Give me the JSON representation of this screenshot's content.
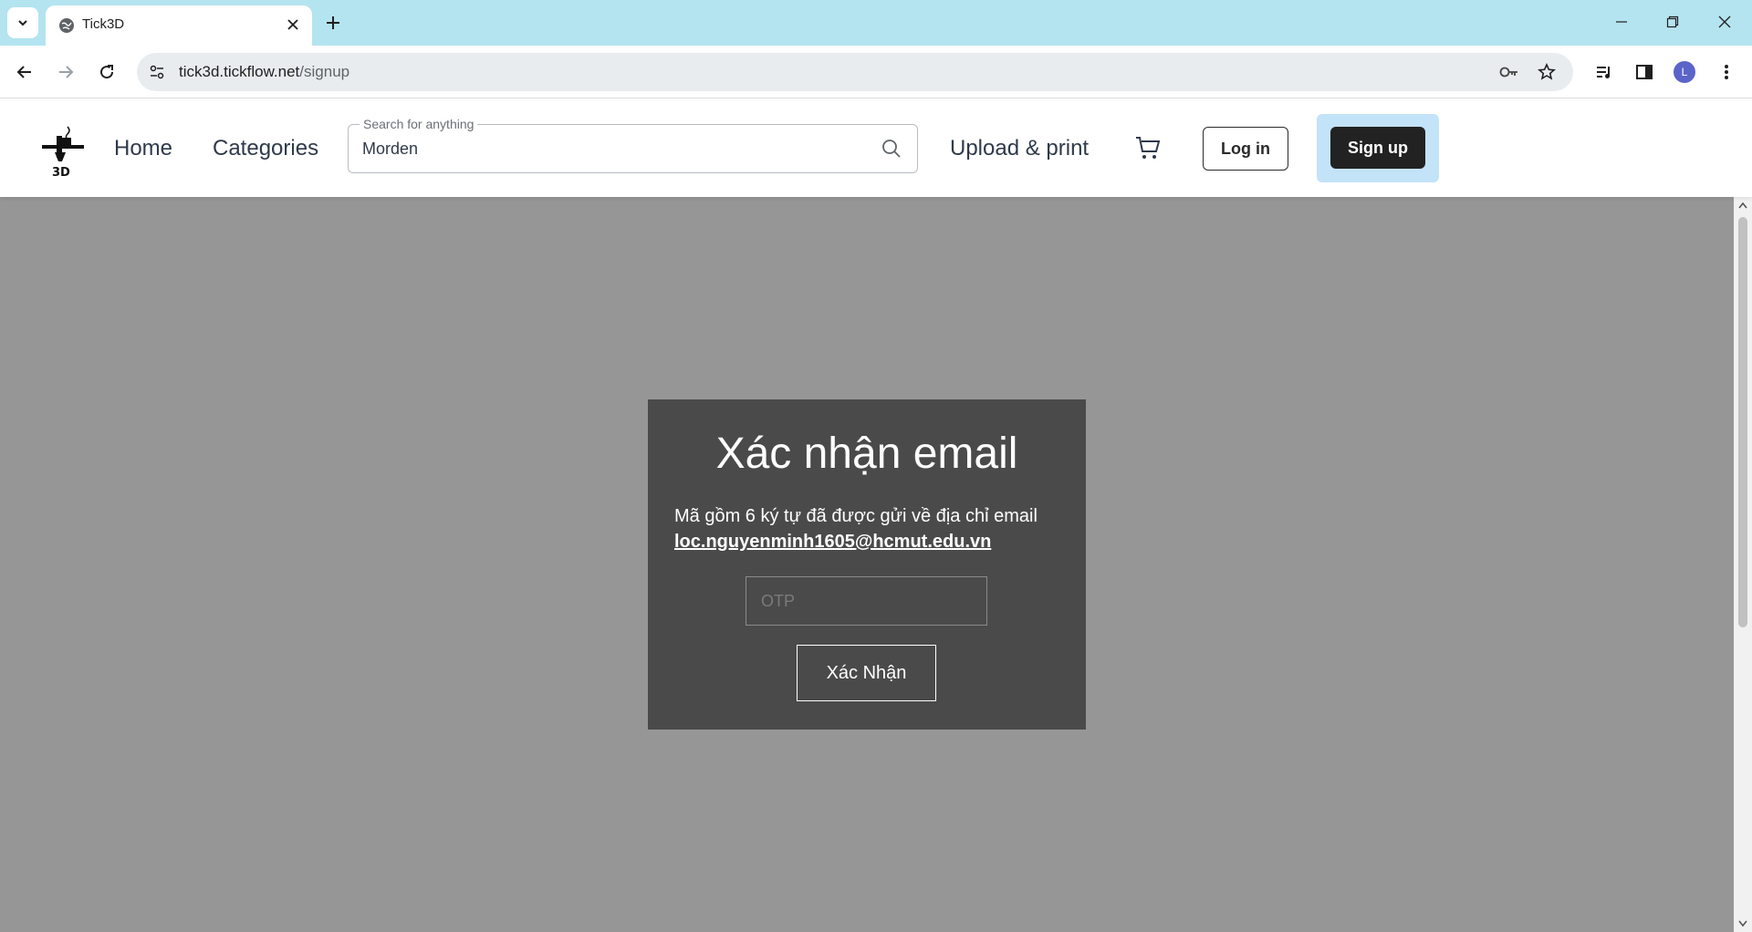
{
  "browser": {
    "tab_title": "Tick3D",
    "url_host": "tick3d.tickflow.net",
    "url_path": "/signup",
    "profile_initial": "L"
  },
  "header": {
    "logo_text": "3D",
    "nav": {
      "home": "Home",
      "categories": "Categories",
      "upload": "Upload & print"
    },
    "search": {
      "legend": "Search for anything",
      "value": "Morden"
    },
    "login_label": "Log in",
    "signup_label": "Sign up"
  },
  "modal": {
    "title": "Xác nhận email",
    "message": "Mã gồm 6 ký tự đã được gửi về địa chỉ email",
    "email": "loc.nguyenminh1605@hcmut.edu.vn",
    "otp_placeholder": "OTP",
    "confirm_label": "Xác Nhận"
  },
  "colors": {
    "tabstrip": "#b4e4f0",
    "overlay": "#969696",
    "modal_bg": "#4a4a4a",
    "signup_highlight": "#c3e3f9",
    "signup_button": "#222222"
  }
}
